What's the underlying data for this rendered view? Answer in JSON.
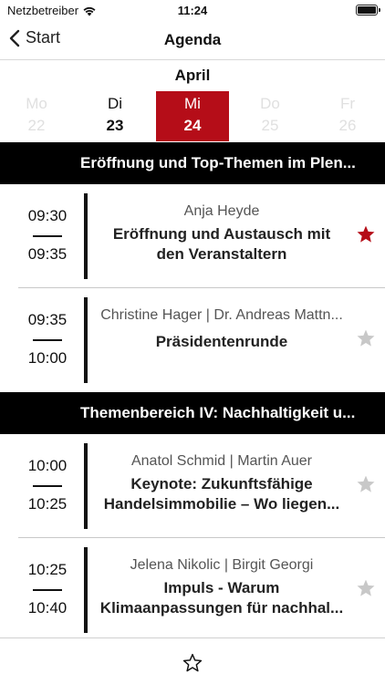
{
  "status_bar": {
    "carrier": "Netzbetreiber",
    "time": "11:24"
  },
  "nav": {
    "back_label": "Start",
    "title": "Agenda"
  },
  "calendar": {
    "month": "April",
    "days": [
      {
        "name": "Mo",
        "number": "22",
        "state": "inactive"
      },
      {
        "name": "Di",
        "number": "23",
        "state": "normal"
      },
      {
        "name": "Mi",
        "number": "24",
        "state": "selected"
      },
      {
        "name": "Do",
        "number": "25",
        "state": "inactive"
      },
      {
        "name": "Fr",
        "number": "26",
        "state": "inactive"
      }
    ]
  },
  "sections": [
    {
      "title": "Eröffnung und Top-Themen im Plen...",
      "sessions": [
        {
          "start": "09:30",
          "end": "09:35",
          "speakers": "Anja Heyde",
          "title_lines": [
            "Eröffnung und Austausch mit",
            "den Veranstaltern"
          ],
          "favorite": true
        },
        {
          "start": "09:35",
          "end": "10:00",
          "speakers": "Christine Hager | Dr. Andreas Mattn...",
          "title_lines": [
            "Präsidentenrunde"
          ],
          "favorite": false
        }
      ]
    },
    {
      "title": "Themenbereich IV: Nachhaltigkeit u...",
      "sessions": [
        {
          "start": "10:00",
          "end": "10:25",
          "speakers": "Anatol Schmid | Martin Auer",
          "title_lines": [
            "Keynote: Zukunftsfähige",
            "Handelsimmobilie – Wo liegen..."
          ],
          "favorite": false
        },
        {
          "start": "10:25",
          "end": "10:40",
          "speakers": "Jelena Nikolic | Birgit Georgi",
          "title_lines": [
            "Impuls - Warum",
            "Klimaanpassungen für nachhal..."
          ],
          "favorite": false
        }
      ]
    }
  ],
  "colors": {
    "accent": "#b50d18",
    "star_active": "#b50d18",
    "star_inactive": "#c8c8c8",
    "section_bg": "#000000"
  },
  "icons": {
    "back": "chevron-left-icon",
    "wifi": "wifi-icon",
    "battery": "battery-icon",
    "favorite": "star-icon",
    "favorites_tab": "star-outline-icon"
  }
}
